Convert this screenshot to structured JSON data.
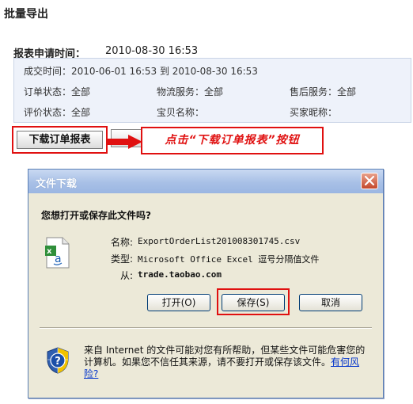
{
  "page": {
    "title": "批量导出"
  },
  "report": {
    "request_time_label": "报表申请时间：",
    "request_time_value": "2010-08-30 16:53"
  },
  "filters": {
    "deal_time": "成交时间：2010-06-01 16:53 到 2010-08-30 16:53",
    "order_status": "订单状态：全部",
    "logistics": "物流服务：全部",
    "after_sale": "售后服务：全部",
    "rating_status": "评价状态：全部",
    "item_name": "宝贝名称：",
    "buyer_nick": "买家昵称："
  },
  "buttons": {
    "download_report": "下载订单报表"
  },
  "callout": {
    "text": "点击“下载订单报表”按钮"
  },
  "dialog": {
    "title": "文件下载",
    "question": "您想打开或保存此文件吗?",
    "name_label": "名称:",
    "name_value": "ExportOrderList201008301745.csv",
    "type_label": "类型:",
    "type_value": "Microsoft Office Excel 逗号分隔值文件",
    "from_label": "从:",
    "from_value": "trade.taobao.com",
    "open_label": "打开(O)",
    "save_label": "保存(S)",
    "cancel_label": "取消",
    "warning_text": "来自 Internet 的文件可能对您有所帮助，但某些文件可能危害您的计算机。如果您不信任其来源，请不要打开或保存该文件。",
    "risk_link": "有何风险?"
  },
  "colors": {
    "highlight": "#e01010",
    "titlebar": "#a8c0e6",
    "dialog_bg": "#ece9d8",
    "panel_bg": "#eef2fa"
  },
  "icons": [
    "excel-csv-file-icon",
    "shield-warning-icon",
    "close-icon",
    "arrow-right-icon"
  ]
}
